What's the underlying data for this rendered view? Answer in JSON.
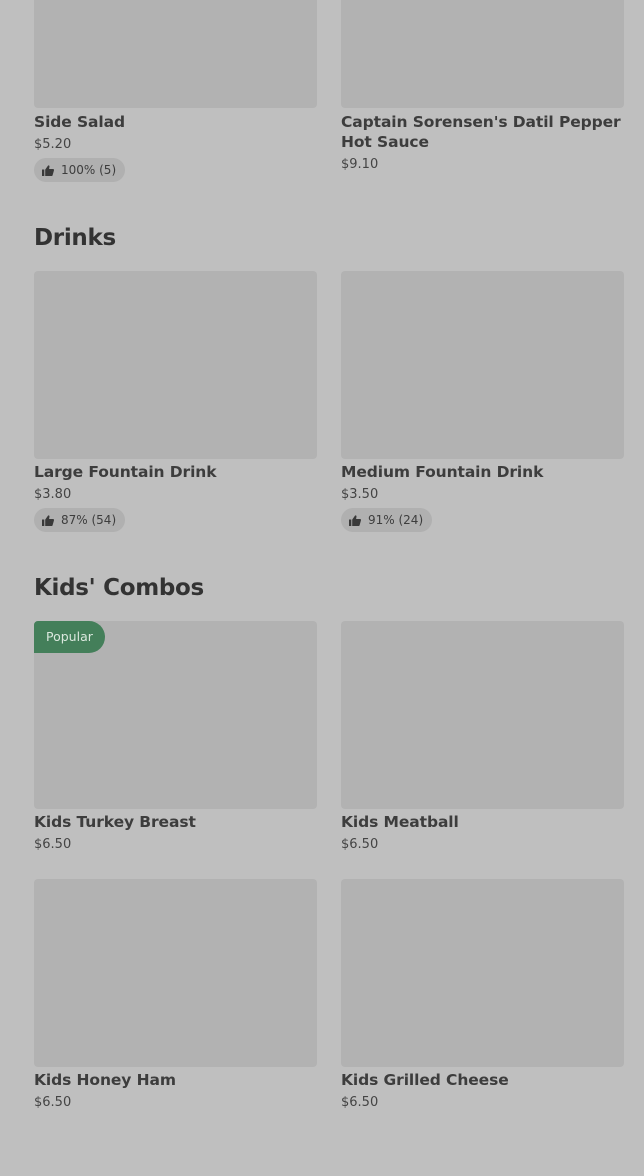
{
  "sections": [
    {
      "title": "",
      "items": [
        {
          "name": "Side Salad",
          "price": "$5.20",
          "rating": "100% (5)"
        },
        {
          "name": "Captain Sorensen's Datil Pepper Hot Sauce",
          "price": "$9.10"
        }
      ]
    },
    {
      "title": "Drinks",
      "items": [
        {
          "name": "Large Fountain Drink",
          "price": "$3.80",
          "rating": "87% (54)"
        },
        {
          "name": "Medium Fountain Drink",
          "price": "$3.50",
          "rating": "91% (24)"
        }
      ]
    },
    {
      "title": "Kids' Combos",
      "items": [
        {
          "name": "Kids Turkey Breast",
          "price": "$6.50",
          "badge": "Popular"
        },
        {
          "name": "Kids Meatball",
          "price": "$6.50"
        },
        {
          "name": "Kids Honey Ham",
          "price": "$6.50"
        },
        {
          "name": "Kids Grilled Cheese",
          "price": "$6.50"
        }
      ]
    }
  ],
  "icons": {
    "rating": "thumbs-up-icon"
  },
  "colors": {
    "background": "#bfbfbf",
    "placeholder": "#b2b2b2",
    "badge": "#447f5a"
  }
}
